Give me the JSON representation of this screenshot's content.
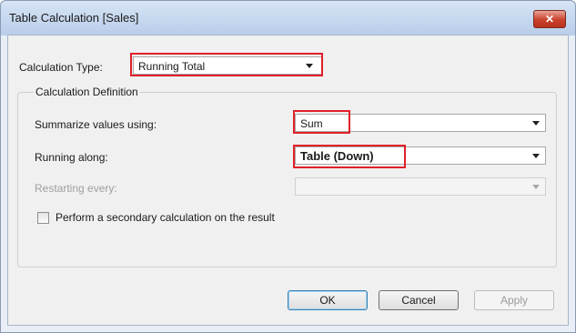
{
  "window": {
    "title": "Table Calculation [Sales]",
    "close_glyph": "✕"
  },
  "calc_type": {
    "label": "Calculation Type:",
    "value": "Running Total"
  },
  "definition": {
    "title": "Calculation Definition",
    "summarize": {
      "label": "Summarize values using:",
      "value": "Sum"
    },
    "running_along": {
      "label": "Running along:",
      "value": "Table (Down)"
    },
    "restarting": {
      "label": "Restarting every:",
      "value": ""
    },
    "secondary": {
      "label": "Perform a secondary calculation on the result",
      "checked": false
    }
  },
  "buttons": {
    "ok": "OK",
    "cancel": "Cancel",
    "apply": "Apply"
  },
  "icons": {
    "close": "close-icon",
    "dropdown": "chevron-down-icon"
  },
  "colors": {
    "highlight": "#e0202a",
    "titlebar": "#c4d7ee",
    "close": "#c9402b"
  }
}
